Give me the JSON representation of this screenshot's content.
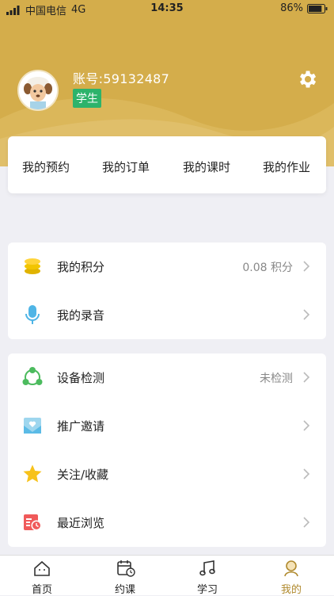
{
  "status_bar": {
    "carrier": "中国电信",
    "network": "4G",
    "time": "14:35",
    "battery": "86%",
    "battery_level": 0.86
  },
  "profile": {
    "account_label": "账号:59132487",
    "role_badge": "学生",
    "avatar_icon": "sheep-avatar-icon",
    "settings_icon": "gear-icon"
  },
  "quick_links": [
    {
      "label": "我的预约"
    },
    {
      "label": "我的订单"
    },
    {
      "label": "我的课时"
    },
    {
      "label": "我的作业"
    }
  ],
  "group1": [
    {
      "label": "我的积分",
      "value": "0.08 积分",
      "icon": "coins-icon"
    },
    {
      "label": "我的录音",
      "value": "",
      "icon": "microphone-icon"
    }
  ],
  "group2": [
    {
      "label": "设备检测",
      "value": "未检测",
      "icon": "share-nodes-icon"
    },
    {
      "label": "推广邀请",
      "value": "",
      "icon": "envelope-heart-icon"
    },
    {
      "label": "关注/收藏",
      "value": "",
      "icon": "star-icon"
    },
    {
      "label": "最近浏览",
      "value": "",
      "icon": "history-icon"
    }
  ],
  "tabs": [
    {
      "label": "首页",
      "icon": "home-icon"
    },
    {
      "label": "约课",
      "icon": "calendar-icon"
    },
    {
      "label": "学习",
      "icon": "music-note-icon"
    },
    {
      "label": "我的",
      "icon": "user-icon",
      "active": true
    }
  ],
  "colors": {
    "header": "#d4ad4b",
    "badge": "#2db36b",
    "active_tab": "#b08a2e"
  }
}
